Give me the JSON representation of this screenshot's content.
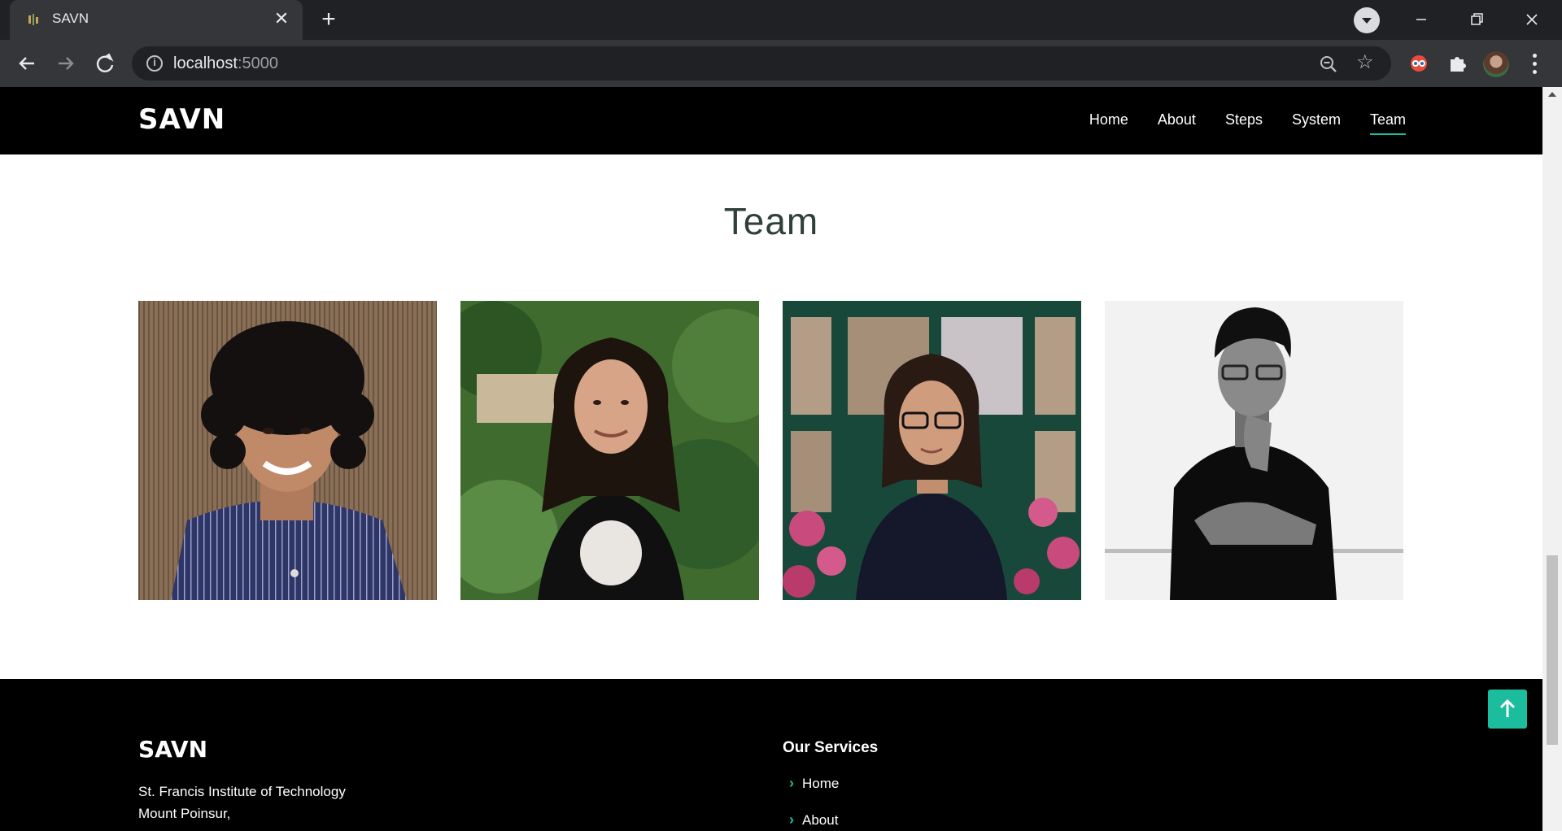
{
  "browser": {
    "tab_title": "SAVN",
    "url_host": "localhost",
    "url_port": ":5000"
  },
  "site": {
    "logo": "SAVN",
    "nav": [
      "Home",
      "About",
      "Steps",
      "System",
      "Team"
    ],
    "active_nav": "Team"
  },
  "team": {
    "title": "Team",
    "members": [
      {
        "photo": "member-photo-1"
      },
      {
        "photo": "member-photo-2"
      },
      {
        "photo": "member-photo-3"
      },
      {
        "photo": "member-photo-4"
      }
    ]
  },
  "footer": {
    "logo": "SAVN",
    "address_line_1": "St. Francis Institute of Technology",
    "address_line_2": "Mount Poinsur,",
    "services_title": "Our Services",
    "services": [
      "Home",
      "About"
    ]
  },
  "colors": {
    "accent": "#1bbd9e",
    "header_bg": "#000000",
    "title_text": "#2f3f3b"
  }
}
